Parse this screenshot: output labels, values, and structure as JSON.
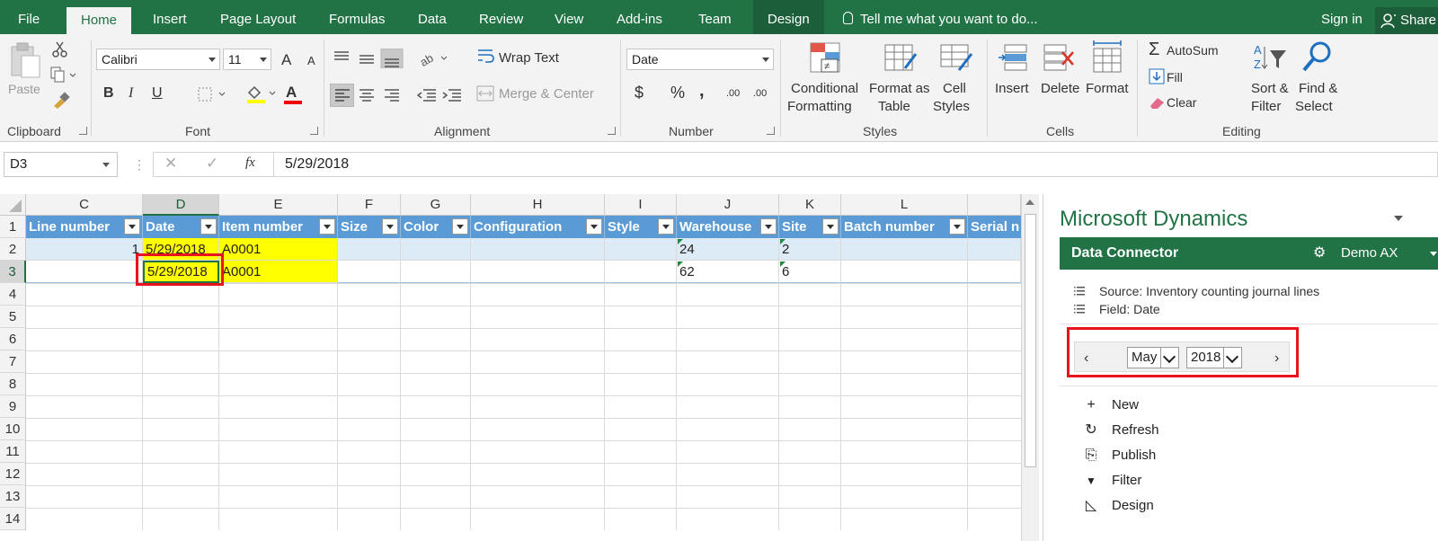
{
  "ribbon_tabs": [
    "File",
    "Home",
    "Insert",
    "Page Layout",
    "Formulas",
    "Data",
    "Review",
    "View",
    "Add-ins",
    "Team",
    "Design"
  ],
  "tell_me": "Tell me what you want to do...",
  "sign_in": "Sign in",
  "share": "Share",
  "clipboard": {
    "paste": "Paste",
    "label": "Clipboard"
  },
  "font": {
    "name": "Calibri",
    "size": "11",
    "bold": "B",
    "italic": "I",
    "underline": "U",
    "grow": "A",
    "shrink": "A",
    "color_a": "A",
    "label": "Font"
  },
  "alignment": {
    "wrap_text": "Wrap Text",
    "merge_center": "Merge & Center",
    "label": "Alignment"
  },
  "number": {
    "format": "Date",
    "currency": "$",
    "percent": "%",
    "comma": ",",
    "inc_dec": ".00",
    "label": "Number"
  },
  "styles": {
    "conditional_1": "Conditional",
    "conditional_2": "Formatting",
    "format_table_1": "Format as",
    "format_table_2": "Table",
    "cell_styles_1": "Cell",
    "cell_styles_2": "Styles",
    "label": "Styles"
  },
  "cells": {
    "insert": "Insert",
    "delete": "Delete",
    "format": "Format",
    "label": "Cells"
  },
  "editing": {
    "autosum": "AutoSum",
    "fill": "Fill",
    "clear": "Clear",
    "sort_1": "Sort &",
    "sort_2": "Filter",
    "find_1": "Find &",
    "find_2": "Select",
    "label": "Editing"
  },
  "formula_bar": {
    "name_box": "D3",
    "fx": "fx",
    "cancel": "✕",
    "enter": "✓",
    "value": "5/29/2018"
  },
  "columns": [
    "C",
    "D",
    "E",
    "F",
    "G",
    "H",
    "I",
    "J",
    "K",
    "L"
  ],
  "rows": [
    "1",
    "2",
    "3",
    "4",
    "5",
    "6",
    "7",
    "8",
    "9",
    "10",
    "11",
    "12",
    "13",
    "14"
  ],
  "table_headers": [
    "Line number",
    "Date",
    "Item number",
    "Size",
    "Color",
    "Configuration",
    "Style",
    "Warehouse",
    "Site",
    "Batch number",
    "Serial n"
  ],
  "table_rows": [
    {
      "line": "1",
      "date": "5/29/2018",
      "item": "A0001",
      "warehouse": "24",
      "site": "2"
    },
    {
      "line": "",
      "date": "5/29/2018",
      "item": "A0001",
      "warehouse": "62",
      "site": "6"
    }
  ],
  "pane": {
    "title": "Microsoft Dynamics",
    "connector": "Data Connector",
    "environment": "Demo AX",
    "source": "Source: Inventory counting journal lines",
    "field": "Field: Date",
    "month": "May",
    "year": "2018",
    "actions": [
      {
        "label": "New",
        "icon": "+"
      },
      {
        "label": "Refresh",
        "icon": "↻"
      },
      {
        "label": "Publish",
        "icon": "⎘"
      },
      {
        "label": "Filter",
        "icon": "▼"
      },
      {
        "label": "Design",
        "icon": "◺"
      }
    ]
  },
  "colors": {
    "excel_green": "#217346",
    "table_header": "#5b9bd5",
    "band": "#ddebf7",
    "highlight": "#ffff00",
    "callout": "#e8141d"
  }
}
